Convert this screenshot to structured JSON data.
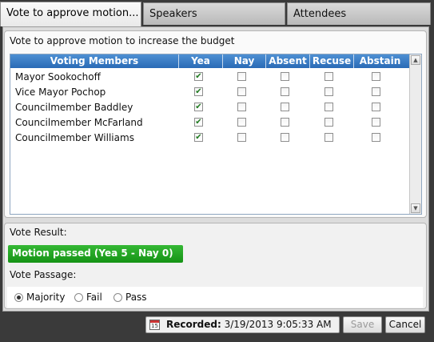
{
  "tabs": [
    "Vote to approve motion...",
    "Speakers",
    "Attendees"
  ],
  "motion_title": "Vote to approve motion to increase the budget",
  "grid": {
    "columns": [
      "Voting Members",
      "Yea",
      "Nay",
      "Absent",
      "Recuse",
      "Abstain"
    ],
    "rows": [
      {
        "name": "Mayor Sookochoff",
        "yea": true,
        "nay": false,
        "absent": false,
        "recuse": false,
        "abstain": false
      },
      {
        "name": "Vice Mayor Pochop",
        "yea": true,
        "nay": false,
        "absent": false,
        "recuse": false,
        "abstain": false
      },
      {
        "name": "Councilmember Baddley",
        "yea": true,
        "nay": false,
        "absent": false,
        "recuse": false,
        "abstain": false
      },
      {
        "name": "Councilmember McFarland",
        "yea": true,
        "nay": false,
        "absent": false,
        "recuse": false,
        "abstain": false
      },
      {
        "name": "Councilmember Williams",
        "yea": true,
        "nay": false,
        "absent": false,
        "recuse": false,
        "abstain": false
      }
    ]
  },
  "vote_result": {
    "label": "Vote Result:",
    "text": "Motion passed (Yea 5 - Nay 0)",
    "color": "#159315"
  },
  "vote_passage": {
    "label": "Vote Passage:",
    "options": [
      "Majority",
      "Fail",
      "Pass"
    ],
    "selected": "Majority"
  },
  "footer": {
    "calendar_icon_text": "15",
    "recorded_label": "Recorded:",
    "recorded_value": "3/19/2013 9:05:33 AM",
    "save_label": "Save",
    "cancel_label": "Cancel"
  },
  "icons": {
    "check": "✔",
    "scroll_up": "▲",
    "scroll_down": "▼"
  }
}
